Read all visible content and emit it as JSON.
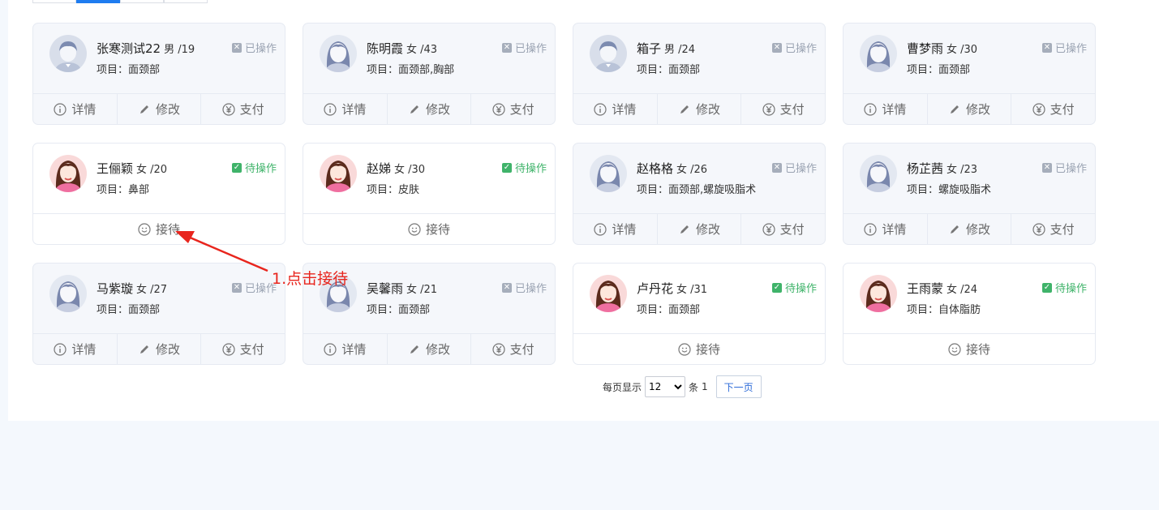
{
  "labels": {
    "detail": "详情",
    "edit": "修改",
    "pay": "支付",
    "receive": "接待",
    "status_done": "已操作",
    "status_wait": "待操作",
    "project_prefix": "项目："
  },
  "cards": [
    {
      "name": "张寒测试22",
      "meta": "男 /19",
      "project": "面颈部",
      "state": "done",
      "avatar": "male"
    },
    {
      "name": "陈明霞",
      "meta": "女 /43",
      "project": "面颈部,胸部",
      "state": "done",
      "avatar": "female-gray"
    },
    {
      "name": "箱子",
      "meta": "男 /24",
      "project": "面颈部",
      "state": "done",
      "avatar": "male"
    },
    {
      "name": "曹梦雨",
      "meta": "女 /30",
      "project": "面颈部",
      "state": "done",
      "avatar": "female-gray"
    },
    {
      "name": "王俪颖",
      "meta": "女 /20",
      "project": "鼻部",
      "state": "wait",
      "avatar": "female-color"
    },
    {
      "name": "赵娣",
      "meta": "女 /30",
      "project": "皮肤",
      "state": "wait",
      "avatar": "female-color"
    },
    {
      "name": "赵格格",
      "meta": "女 /26",
      "project": "面颈部,螺旋吸脂术",
      "state": "done",
      "avatar": "female-gray"
    },
    {
      "name": "杨芷茜",
      "meta": "女 /23",
      "project": "螺旋吸脂术",
      "state": "done",
      "avatar": "female-gray"
    },
    {
      "name": "马紫璇",
      "meta": "女 /27",
      "project": "面颈部",
      "state": "done",
      "avatar": "female-gray"
    },
    {
      "name": "吴馨雨",
      "meta": "女 /21",
      "project": "面颈部",
      "state": "done",
      "avatar": "female-gray"
    },
    {
      "name": "卢丹花",
      "meta": "女 /31",
      "project": "面颈部",
      "state": "wait",
      "avatar": "female-color"
    },
    {
      "name": "王雨蒙",
      "meta": "女 /24",
      "project": "自体脂肪",
      "state": "wait",
      "avatar": "female-color"
    }
  ],
  "pager": {
    "per_page_label": "每页显示",
    "per_page_value": "12",
    "unit": "条",
    "total": "1",
    "next_label": "下一页"
  },
  "annotation": {
    "text": "1.点击接待"
  },
  "colors": {
    "accent": "#1e7cf0",
    "done": "#a6aebb",
    "wait": "#3fb36a",
    "annotation": "#e8251d"
  }
}
